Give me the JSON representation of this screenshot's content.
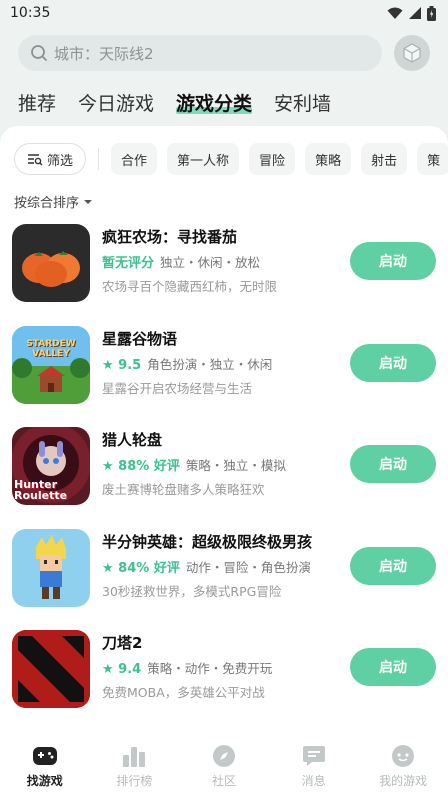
{
  "status_bar": {
    "time": "10:35"
  },
  "search": {
    "placeholder": "城市：天际线2"
  },
  "main_tabs": [
    {
      "label": "推荐"
    },
    {
      "label": "今日游戏"
    },
    {
      "label": "游戏分类"
    },
    {
      "label": "安利墙"
    }
  ],
  "active_tab": "游戏分类",
  "filters": {
    "filter_label": "筛选",
    "chips": [
      "合作",
      "第一人称",
      "冒险",
      "策略",
      "射击",
      "策"
    ]
  },
  "sort": {
    "label": "按综合排序"
  },
  "games": [
    {
      "title": "疯狂农场：寻找番茄",
      "rating": "暂无评分",
      "tags": "独立・休闲・放松",
      "desc": "农场寻百个隐藏西红柿，无时限",
      "button": "启动",
      "icon": "tomato-icon"
    },
    {
      "title": "星露谷物语",
      "rating": "★ 9.5",
      "tags": "角色扮演・独立・休闲",
      "desc": "星露谷开启农场经营与生活",
      "button": "启动",
      "icon": "stardew-icon",
      "icon_text": "STARDEW VALLEY"
    },
    {
      "title": "猎人轮盘",
      "rating": "★ 88% 好评",
      "tags": "策略・独立・模拟",
      "desc": "废土赛博轮盘赌多人策略狂欢",
      "button": "启动",
      "icon": "hunter-roulette-icon",
      "icon_text": "Hunter Roulette"
    },
    {
      "title": "半分钟英雄：超级极限终极男孩",
      "rating": "★ 84% 好评",
      "tags": "动作・冒险・角色扮演",
      "desc": "30秒拯救世界，多模式RPG冒险",
      "button": "启动",
      "icon": "pixel-hero-icon"
    },
    {
      "title": "刀塔2",
      "rating": "★ 9.4",
      "tags": "策略・动作・免费开玩",
      "desc": "免费MOBA，多英雄公平对战",
      "button": "启动",
      "icon": "dota2-icon"
    }
  ],
  "bottom_nav": [
    {
      "label": "找游戏",
      "icon": "gamepad-icon"
    },
    {
      "label": "排行榜",
      "icon": "ranking-icon"
    },
    {
      "label": "社区",
      "icon": "compass-icon"
    },
    {
      "label": "消息",
      "icon": "message-icon"
    },
    {
      "label": "我的游戏",
      "icon": "profile-icon"
    }
  ],
  "colors": {
    "accent": "#5fd0a3",
    "rating": "#3cc28e",
    "background": "#eef3f2"
  }
}
